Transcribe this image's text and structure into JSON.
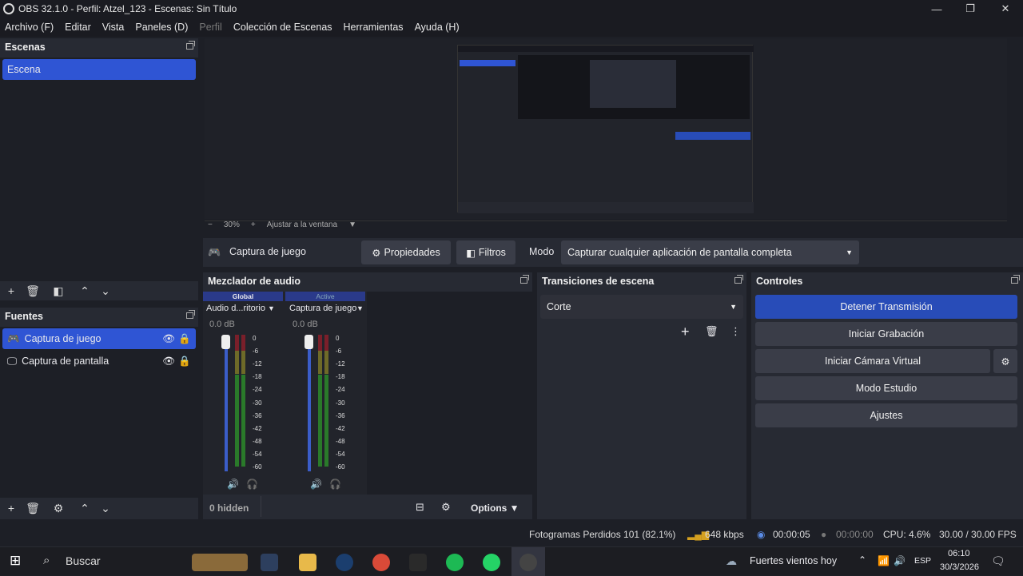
{
  "window": {
    "title": "OBS 32.1.0 - Perfil: Atzel_123 - Escenas: Sin Título",
    "min": "—",
    "max": "❐",
    "close": "✕"
  },
  "menu": [
    "Archivo (F)",
    "Editar",
    "Vista",
    "Paneles (D)",
    "Perfil",
    "Colección de Escenas",
    "Herramientas",
    "Ayuda (H)"
  ],
  "preview": {
    "zoom": "30%",
    "fit": "Ajustar a la ventana"
  },
  "scenes": {
    "title": "Escenas",
    "items": [
      "Escena"
    ]
  },
  "sources": {
    "title": "Fuentes",
    "items": [
      "Captura de juego",
      "Captura de pantalla"
    ]
  },
  "sourcebar": {
    "name": "Captura de juego",
    "properties": "Propiedades",
    "filters": "Filtros",
    "mode_label": "Modo",
    "mode_value": "Capturar cualquier aplicación de pantalla completa"
  },
  "mixer": {
    "title": "Mezclador de audio",
    "hidden": "0 hidden",
    "options": "Options",
    "channels": [
      {
        "tag": "Global",
        "name": "Audio d...ritorio",
        "db": "0.0 dB"
      },
      {
        "tag": "Active",
        "name": "Captura de juego",
        "db": "0.0 dB"
      }
    ],
    "ticks": [
      "0",
      "-6",
      "-12",
      "-18",
      "-24",
      "-30",
      "-36",
      "-42",
      "-48",
      "-54",
      "-60"
    ]
  },
  "transitions": {
    "title": "Transiciones de escena",
    "value": "Corte"
  },
  "controls": {
    "title": "Controles",
    "stop_stream": "Detener Transmisión",
    "start_rec": "Iniciar Grabación",
    "virtual_cam": "Iniciar Cámara Virtual",
    "studio": "Modo Estudio",
    "settings": "Ajustes"
  },
  "status": {
    "dropped": "Fotogramas Perdidos 101 (82.1%)",
    "kbps": "648 kbps",
    "stream_time": "00:00:05",
    "rec_time": "00:00:00",
    "cpu": "CPU: 4.6%",
    "fps": "30.00 / 30.00 FPS"
  },
  "taskbar": {
    "search": "Buscar",
    "weather": "Fuertes vientos hoy",
    "lang": "ESP",
    "time": "06:10",
    "date": "30/3/2026"
  },
  "colors": {
    "accent": "#284cb8",
    "selected": "#2f55d4",
    "panel": "#272a33",
    "bg": "#1d1f26"
  }
}
